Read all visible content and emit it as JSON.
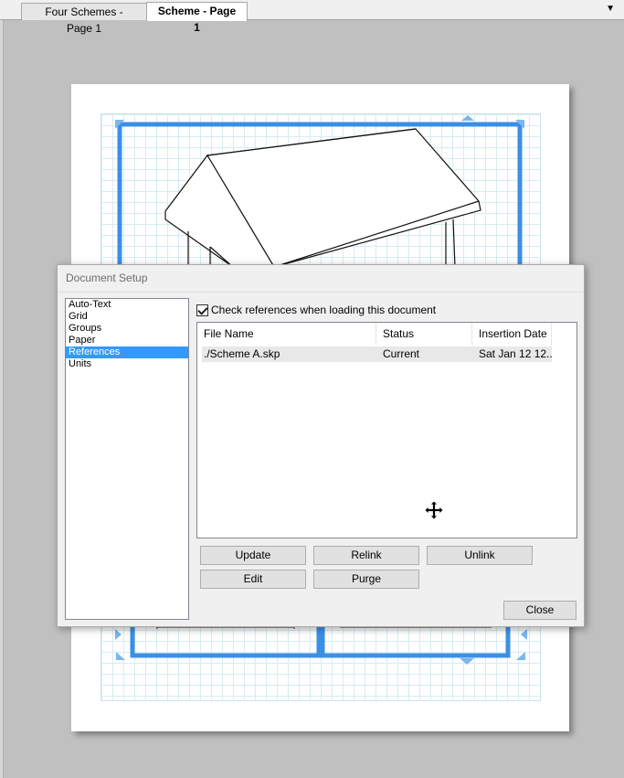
{
  "tabs": [
    {
      "label": "Four Schemes - Page 1"
    },
    {
      "label": "Scheme - Page 1"
    }
  ],
  "tab_dropdown_icon": "chevron-down-icon",
  "dialog": {
    "title": "Document Setup",
    "categories": [
      "Auto-Text",
      "Grid",
      "Groups",
      "Paper",
      "References",
      "Units"
    ],
    "selected_category": "References",
    "checkbox_label": "Check references when loading this document",
    "checkbox_checked": true,
    "table": {
      "headers": [
        "File Name",
        "Status",
        "Insertion Date"
      ],
      "rows": [
        {
          "file": "./Scheme A.skp",
          "status": "Current",
          "date": "Sat Jan 12 12..."
        }
      ]
    },
    "buttons": {
      "update": "Update",
      "relink": "Relink",
      "unlink": "Unlink",
      "edit": "Edit",
      "purge": "Purge",
      "close": "Close"
    }
  },
  "colors": {
    "selection_blue": "#3399ff",
    "viewport_blue": "#3b8fe6",
    "grid_line": "#d8ecef"
  }
}
